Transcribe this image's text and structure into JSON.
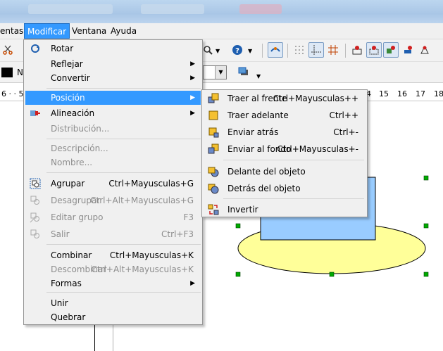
{
  "menubar": {
    "items": [
      {
        "label": "entas"
      },
      {
        "label": "Modificar"
      },
      {
        "label": "Ventana"
      },
      {
        "label": "Ayuda"
      }
    ]
  },
  "toolbar": {
    "font_name_fragment": "N"
  },
  "ruler": {
    "ticks_left": "6 · · 5",
    "ticks_right": [
      "4",
      "15",
      "16",
      "17",
      "18"
    ]
  },
  "menu": {
    "items": [
      {
        "label": "Rotar",
        "shortcut": "",
        "submenu": false,
        "enabled": true,
        "icon": "rotate-icon"
      },
      {
        "label": "Reflejar",
        "shortcut": "",
        "submenu": true,
        "enabled": true
      },
      {
        "label": "Convertir",
        "shortcut": "",
        "submenu": true,
        "enabled": true
      },
      {
        "label": "Posición",
        "shortcut": "",
        "submenu": true,
        "enabled": true,
        "highlighted": true
      },
      {
        "label": "Alineación",
        "shortcut": "",
        "submenu": true,
        "enabled": true,
        "icon": "align-icon"
      },
      {
        "label": "Distribución...",
        "shortcut": "",
        "submenu": false,
        "enabled": false
      },
      {
        "label": "Descripción...",
        "shortcut": "",
        "submenu": false,
        "enabled": false
      },
      {
        "label": "Nombre...",
        "shortcut": "",
        "submenu": false,
        "enabled": false
      },
      {
        "label": "Agrupar",
        "shortcut": "Ctrl+Mayusculas+G",
        "submenu": false,
        "enabled": true,
        "icon": "group-icon"
      },
      {
        "label": "Desagrupar",
        "shortcut": "Ctrl+Alt+Mayusculas+G",
        "submenu": false,
        "enabled": false,
        "icon": "ungroup-icon"
      },
      {
        "label": "Editar grupo",
        "shortcut": "F3",
        "submenu": false,
        "enabled": false,
        "icon": "edit-group-icon"
      },
      {
        "label": "Salir",
        "shortcut": "Ctrl+F3",
        "submenu": false,
        "enabled": false,
        "icon": "exit-group-icon"
      },
      {
        "label": "Combinar",
        "shortcut": "Ctrl+Mayusculas+K",
        "submenu": false,
        "enabled": true
      },
      {
        "label": "Descombinar",
        "shortcut": "Ctrl+Alt+Mayusculas+K",
        "submenu": false,
        "enabled": false
      },
      {
        "label": "Formas",
        "shortcut": "",
        "submenu": true,
        "enabled": true
      },
      {
        "label": "Unir",
        "shortcut": "",
        "submenu": false,
        "enabled": true
      },
      {
        "label": "Quebrar",
        "shortcut": "",
        "submenu": false,
        "enabled": true
      }
    ]
  },
  "submenu": {
    "items": [
      {
        "label": "Traer al frente",
        "shortcut": "Ctrl+Mayusculas++",
        "icon": "bring-to-front-icon"
      },
      {
        "label": "Traer adelante",
        "shortcut": "Ctrl++",
        "icon": "bring-forward-icon"
      },
      {
        "label": "Enviar atrás",
        "shortcut": "Ctrl+-",
        "icon": "send-backward-icon"
      },
      {
        "label": "Enviar al fondo",
        "shortcut": "Ctrl+Mayusculas+-",
        "icon": "send-to-back-icon"
      },
      {
        "label": "Delante del objeto",
        "shortcut": "",
        "icon": "in-front-of-object-icon"
      },
      {
        "label": "Detrás del objeto",
        "shortcut": "",
        "icon": "behind-object-icon"
      },
      {
        "label": "Invertir",
        "shortcut": "",
        "icon": "reverse-icon"
      }
    ]
  },
  "colors": {
    "highlight": "#3399ff",
    "menu_bg": "#f0f0f0",
    "ellipse_fill": "#ffff99",
    "rect_fill": "#99ccff",
    "handle": "#00aa00"
  }
}
